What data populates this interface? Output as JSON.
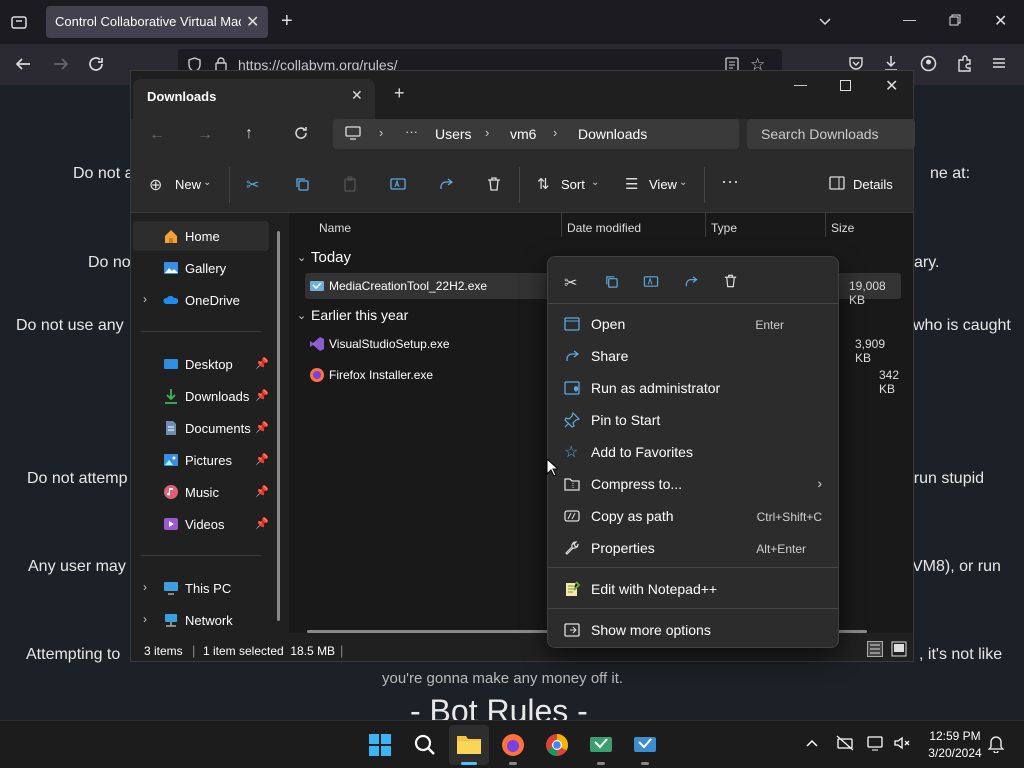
{
  "browser": {
    "tab_title": "Control Collaborative Virtual Machi",
    "url": "https://collabvm.org/rules/"
  },
  "page": {
    "lines": [
      "Do not a",
      "ne at:",
      "Do no",
      "ary.",
      "Do not use any",
      "who is caught",
      "Do not attemp",
      "r run stupid",
      "Any user may",
      "VM8), or run",
      "Attempting to",
      ", it's not like",
      "you're gonna make any money off it.",
      "- Bot Rules -"
    ]
  },
  "explorer": {
    "tab_title": "Downloads",
    "breadcrumb": [
      "Users",
      "vm6",
      "Downloads"
    ],
    "search_placeholder": "Search Downloads",
    "toolbar": {
      "new": "New",
      "sort": "Sort",
      "view": "View",
      "details": "Details"
    },
    "nav": {
      "home": "Home",
      "gallery": "Gallery",
      "onedrive": "OneDrive",
      "desktop": "Desktop",
      "downloads": "Downloads",
      "documents": "Documents",
      "pictures": "Pictures",
      "music": "Music",
      "videos": "Videos",
      "thispc": "This PC",
      "network": "Network"
    },
    "columns": {
      "name": "Name",
      "date": "Date modified",
      "type": "Type",
      "size": "Size"
    },
    "groups": {
      "today": "Today",
      "earlier": "Earlier this year"
    },
    "files": [
      {
        "name": "MediaCreationTool_22H2.exe",
        "size": "19,008 KB"
      },
      {
        "name": "VisualStudioSetup.exe",
        "size": "3,909 KB"
      },
      {
        "name": "Firefox Installer.exe",
        "size": "342 KB"
      }
    ],
    "status": {
      "items": "3 items",
      "selected": "1 item selected  18.5 MB"
    }
  },
  "context_menu": {
    "items": [
      {
        "label": "Open",
        "shortcut": "Enter"
      },
      {
        "label": "Share",
        "shortcut": ""
      },
      {
        "label": "Run as administrator",
        "shortcut": ""
      },
      {
        "label": "Pin to Start",
        "shortcut": ""
      },
      {
        "label": "Add to Favorites",
        "shortcut": ""
      },
      {
        "label": "Compress to...",
        "shortcut": ""
      },
      {
        "label": "Copy as path",
        "shortcut": "Ctrl+Shift+C"
      },
      {
        "label": "Properties",
        "shortcut": "Alt+Enter"
      },
      {
        "label": "Edit with Notepad++",
        "shortcut": ""
      },
      {
        "label": "Show more options",
        "shortcut": ""
      }
    ]
  },
  "taskbar": {
    "time": "12:59 PM",
    "date": "3/20/2024"
  },
  "colors": {
    "accent": "#0078d4",
    "folder": "#f5c542"
  }
}
